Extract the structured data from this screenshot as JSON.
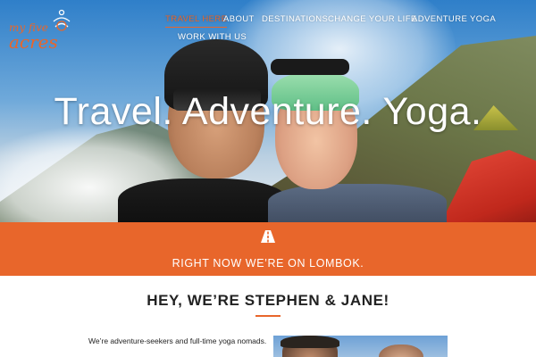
{
  "brand": {
    "logo_line1": "my five",
    "logo_line2": "acres",
    "accent_color": "#e8662b"
  },
  "nav": {
    "items": [
      {
        "label": "Travel Here",
        "active": true
      },
      {
        "label": "About",
        "active": false
      },
      {
        "label": "Destinations",
        "active": false
      },
      {
        "label": "Change Your Life",
        "active": false
      },
      {
        "label": "Adventure Yoga",
        "active": false
      },
      {
        "label": "Work With Us",
        "active": false
      }
    ]
  },
  "hero": {
    "title": "Travel. Adventure. Yoga."
  },
  "location_band": {
    "icon": "road-icon",
    "text": "Right now we’re on Lombok.",
    "background": "#e8662b"
  },
  "intro": {
    "heading": "Hey, we’re Stephen & Jane!",
    "text": "We’re adventure-seekers and full-time yoga nomads."
  }
}
